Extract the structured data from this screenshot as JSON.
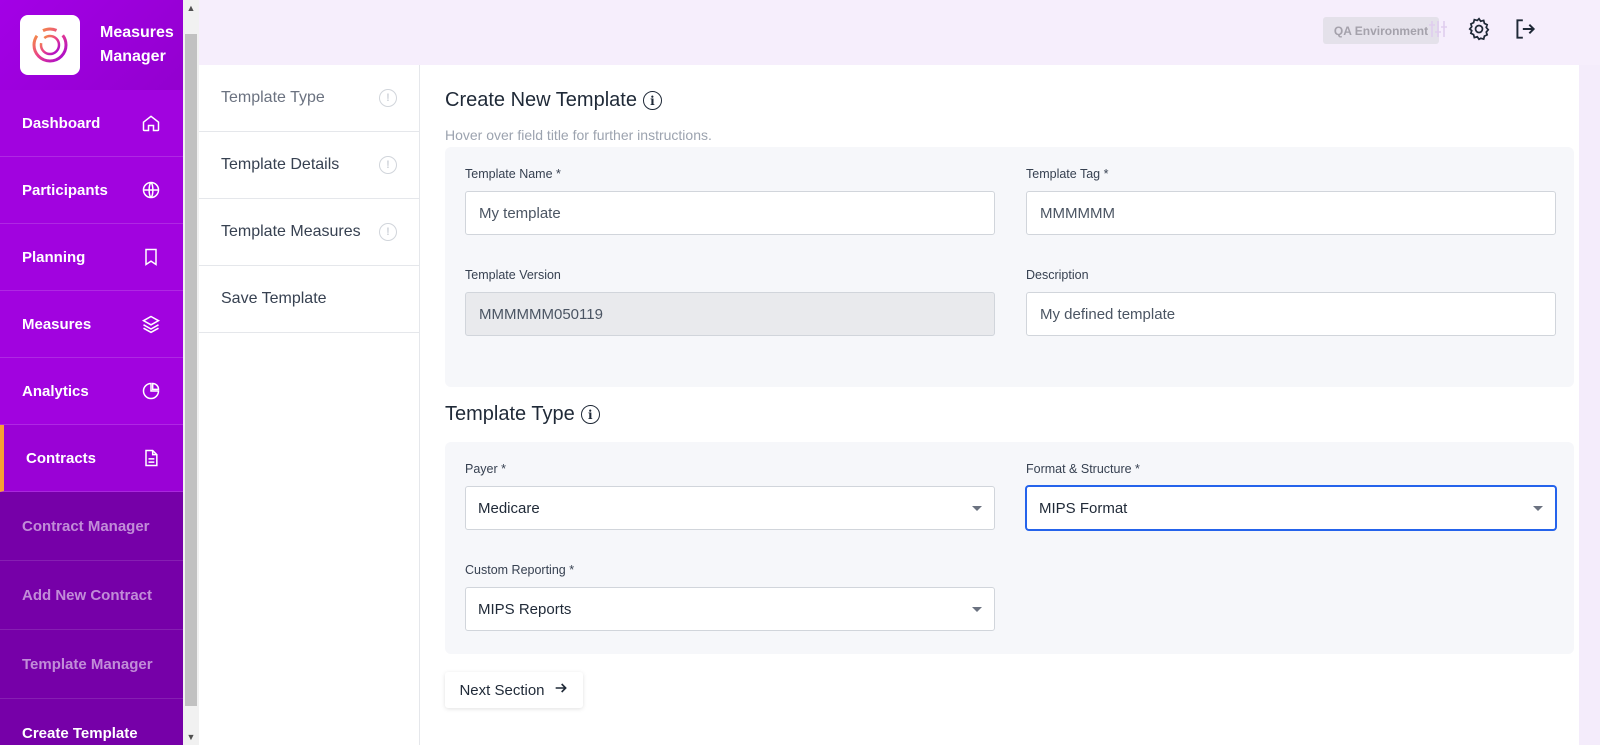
{
  "app": {
    "name_line1": "Measures",
    "name_line2": "Manager"
  },
  "sidebar": {
    "items": [
      {
        "label": "Dashboard",
        "icon": "home-icon"
      },
      {
        "label": "Participants",
        "icon": "globe-icon"
      },
      {
        "label": "Planning",
        "icon": "bookmark-icon"
      },
      {
        "label": "Measures",
        "icon": "layers-icon"
      },
      {
        "label": "Analytics",
        "icon": "pie-chart-icon"
      },
      {
        "label": "Contracts",
        "icon": "document-icon"
      }
    ],
    "sub_items": [
      {
        "label": "Contract Manager"
      },
      {
        "label": "Add New Contract"
      },
      {
        "label": "Template Manager"
      },
      {
        "label": "Create Template"
      }
    ]
  },
  "topbar": {
    "environment": "QA Environment"
  },
  "steps": [
    {
      "label": "Template Type"
    },
    {
      "label": "Template Details"
    },
    {
      "label": "Template Measures"
    },
    {
      "label": "Save Template"
    }
  ],
  "form": {
    "title": "Create New Template",
    "subtitle": "Hover over field title for further instructions.",
    "template_name_label": "Template Name *",
    "template_name_value": "My template",
    "template_tag_label": "Template Tag *",
    "template_tag_value": "MMMMMM",
    "template_version_label": "Template Version",
    "template_version_value": "MMMMMM050119",
    "description_label": "Description",
    "description_value": "My defined template"
  },
  "type_section": {
    "title": "Template Type",
    "payer_label": "Payer *",
    "payer_value": "Medicare",
    "format_label": "Format & Structure *",
    "format_value": "MIPS Format",
    "custom_label": "Custom Reporting *",
    "custom_value": "MIPS Reports"
  },
  "actions": {
    "next_label": "Next Section"
  },
  "colors": {
    "sidebar": "#9d00d9",
    "accent": "#f7a035",
    "focus": "#2563eb"
  }
}
